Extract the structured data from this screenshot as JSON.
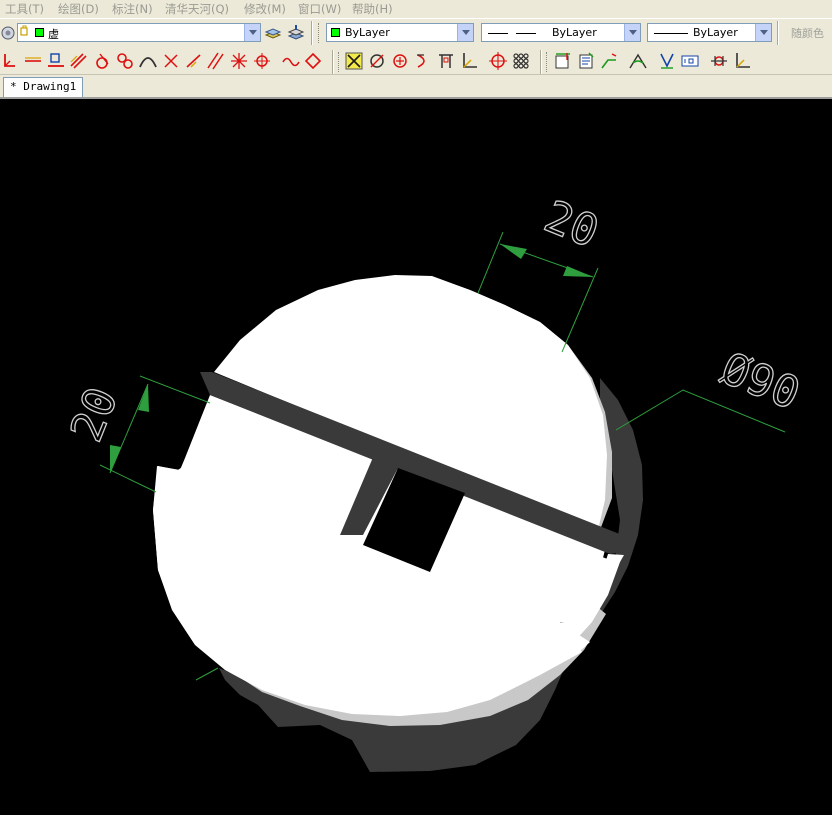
{
  "menu": [
    "工具(T)",
    "绘图(D)",
    "标注(N)",
    "清华天河(Q)",
    "修改(M)",
    "窗口(W)",
    "帮助(H)"
  ],
  "layer_combo": {
    "value": "虚"
  },
  "color_combo": {
    "value": "ByLayer",
    "swatch": "#00ff00"
  },
  "linetype_combo": {
    "value": "ByLayer"
  },
  "lineweight_combo": {
    "value": "ByLayer"
  },
  "plot_style": {
    "label": "随颜色"
  },
  "tab": {
    "label": "* Drawing1"
  },
  "drawing": {
    "dimensions": [
      {
        "text": "20",
        "role": "slot-width"
      },
      {
        "text": "20",
        "role": "slot-depth"
      },
      {
        "text": "Ø90",
        "role": "diameter"
      }
    ],
    "background": "#000000",
    "dimension_color": "#2e9e3e",
    "part_color": "#ffffff",
    "shadow_color": "#3a3a3a"
  }
}
